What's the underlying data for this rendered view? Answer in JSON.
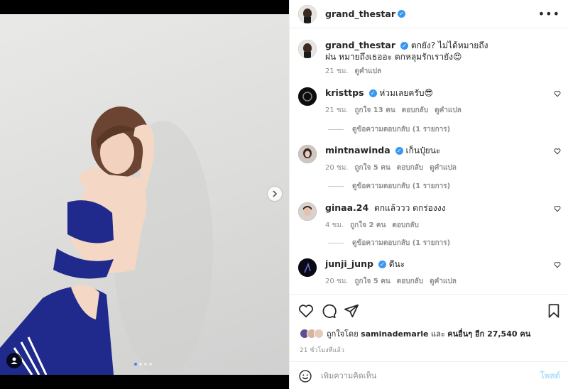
{
  "post": {
    "author": "grand_thestar",
    "caption": "ตกยัง? ไม่ได้หมายถึงฝน หมายถึงเธออะ ตกหลุมรักเรายัง😍",
    "caption_time": "21 ชม.",
    "caption_translate": "ดูคำแปล"
  },
  "comments": [
    {
      "user": "kristtps",
      "verified": true,
      "text": "ห่วมเลยครับ😎",
      "time": "21 ชม.",
      "likes": "ถูกใจ 13 คน",
      "reply": "ตอบกลับ",
      "translate": "ดูคำแปล",
      "replies": "ดูข้อความตอบกลับ (1 รายการ)"
    },
    {
      "user": "mintnawinda",
      "verified": true,
      "text": "เก็นปุ๋ยนะ",
      "time": "20 ชม.",
      "likes": "ถูกใจ 5 คน",
      "reply": "ตอบกลับ",
      "translate": "ดูคำแปล",
      "replies": "ดูข้อความตอบกลับ (1 รายการ)"
    },
    {
      "user": "ginaa.24",
      "verified": false,
      "text": "ตกแล้ววว ตกร่องงง",
      "time": "4 ชม.",
      "likes": "ถูกใจ 2 คน",
      "reply": "ตอบกลับ",
      "translate": "",
      "replies": "ดูข้อความตอบกลับ (1 รายการ)"
    },
    {
      "user": "junji_junp",
      "verified": true,
      "text": "ดีนะ",
      "time": "20 ชม.",
      "likes": "ถูกใจ 5 คน",
      "reply": "ตอบกลับ",
      "translate": "ดูคำแปล",
      "replies": ""
    }
  ],
  "likes": {
    "prefix": "ถูกใจโดย",
    "first_user": "saminademarle",
    "joiner": "และ",
    "others": "คนอื่นๆ อีก 27,540 คน"
  },
  "posted_ago": "21 ชั่วโมงที่แล้ว",
  "add_comment": {
    "placeholder": "เพิ่มความคิดเห็น",
    "post_label": "โพสต์"
  },
  "carousel": {
    "count": 4,
    "active": 1
  },
  "colors": {
    "verified": "#3897f0",
    "outfit": "#1f2a8c",
    "post_disabled": "#b2dffc"
  }
}
